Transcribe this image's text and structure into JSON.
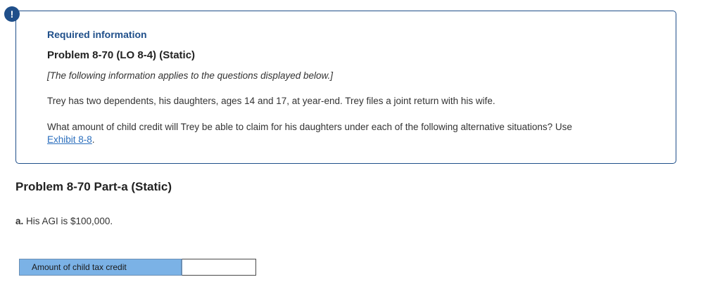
{
  "alert": {
    "icon": "alert-icon",
    "glyph": "!",
    "color": "#1f4f8a"
  },
  "info": {
    "required_title": "Required information",
    "problem_title": "Problem 8-70 (LO 8-4) (Static)",
    "applies_note": "[The following information applies to the questions displayed below.]",
    "paragraph_1": "Trey has two dependents, his daughters, ages 14 and 17, at year-end. Trey files a joint return with his wife.",
    "paragraph_2_text": "What amount of child credit will Trey be able to claim for his daughters under each of the following alternative situations? Use ",
    "exhibit_link": "Exhibit 8-8",
    "paragraph_2_end": "."
  },
  "part": {
    "heading": "Problem 8-70 Part-a (Static)",
    "question_letter": "a.",
    "question_text": " His AGI is $100,000."
  },
  "answer": {
    "label": "Amount of child tax credit",
    "value": ""
  },
  "colors": {
    "brand_blue": "#1f4f8a",
    "link_blue": "#2a6ebd",
    "label_fill": "#7bb2e6"
  }
}
